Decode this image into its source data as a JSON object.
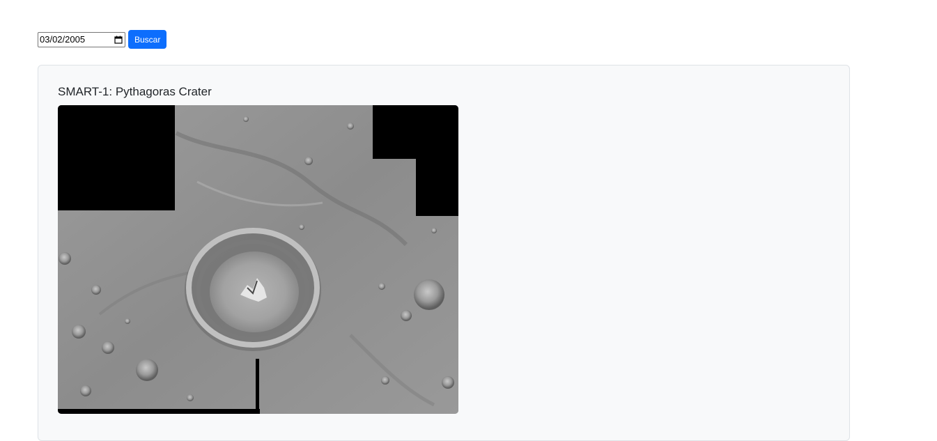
{
  "search": {
    "date_value": "03/02/2005",
    "button_label": "Buscar",
    "calendar_icon": "calendar-icon"
  },
  "card": {
    "title": "SMART-1: Pythagoras Crater",
    "image_alt": "lunar crater mosaic image"
  },
  "colors": {
    "button": "#0d6efd",
    "card_bg": "#f8f9fa",
    "card_border": "#dee2e6"
  }
}
